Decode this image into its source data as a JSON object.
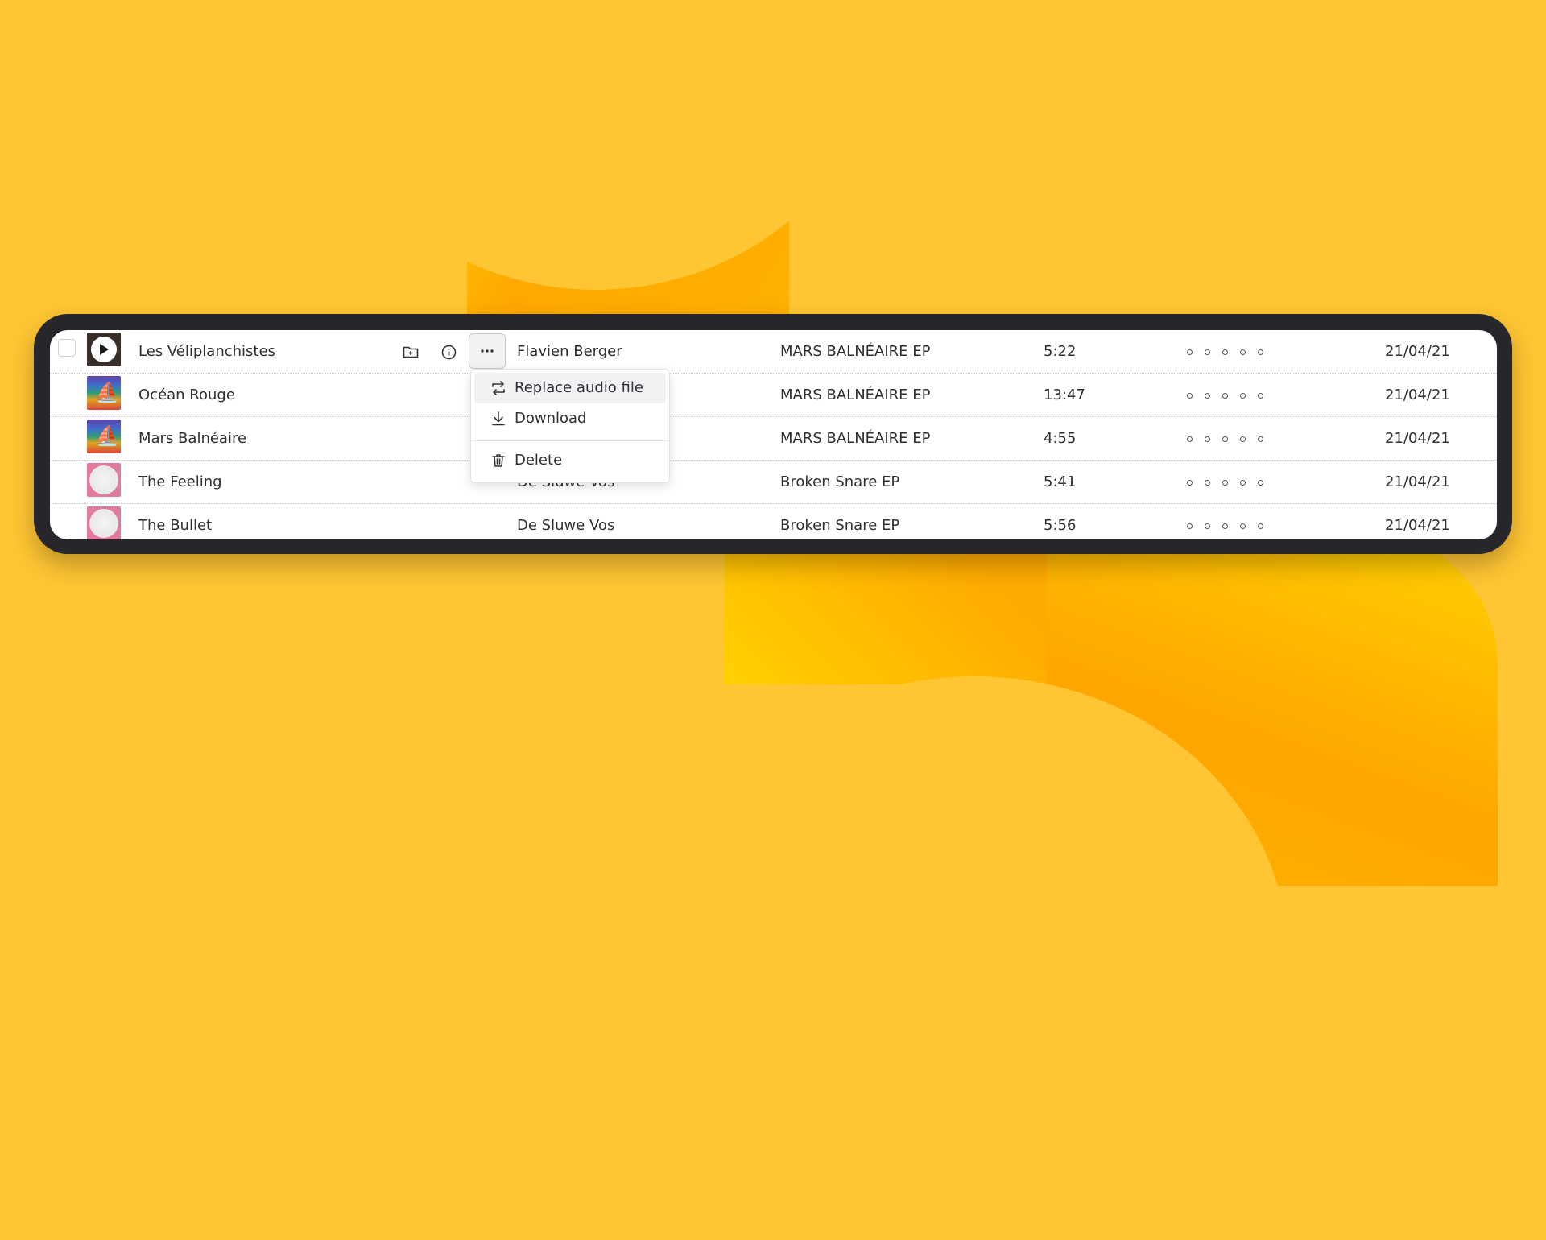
{
  "theme": {
    "background": "#FFC533",
    "frame": "#26262B",
    "accent_orange": "#FFA800"
  },
  "tracks": [
    {
      "title": "Les Véliplanchistes",
      "artist": "Flavien Berger",
      "album": "MARS BALNÉAIRE EP",
      "duration": "5:22",
      "rating": 0,
      "date": "21/04/21",
      "artwork": "dark-cover"
    },
    {
      "title": "Océan Rouge",
      "artist": "",
      "album": "MARS BALNÉAIRE EP",
      "duration": "13:47",
      "rating": 0,
      "date": "21/04/21",
      "artwork": "rainbow-cover"
    },
    {
      "title": "Mars Balnéaire",
      "artist": "",
      "album": "MARS BALNÉAIRE EP",
      "duration": "4:55",
      "rating": 0,
      "date": "21/04/21",
      "artwork": "rainbow-cover"
    },
    {
      "title": "The Feeling",
      "artist": "De Sluwe Vos",
      "album": "Broken Snare EP",
      "duration": "5:41",
      "rating": 0,
      "date": "21/04/21",
      "artwork": "pink-cover"
    },
    {
      "title": "The Bullet",
      "artist": "De Sluwe Vos",
      "album": "Broken Snare EP",
      "duration": "5:56",
      "rating": 0,
      "date": "21/04/21",
      "artwork": "pink-cover"
    }
  ],
  "row_actions": {
    "add_to_folder_icon": "folder-plus-icon",
    "info_icon": "info-icon",
    "more_icon": "more-horizontal-icon"
  },
  "context_menu": {
    "items": [
      {
        "label": "Replace audio file",
        "icon": "replace-icon"
      },
      {
        "label": "Download",
        "icon": "download-icon"
      },
      {
        "label": "Delete",
        "icon": "trash-icon"
      }
    ]
  }
}
